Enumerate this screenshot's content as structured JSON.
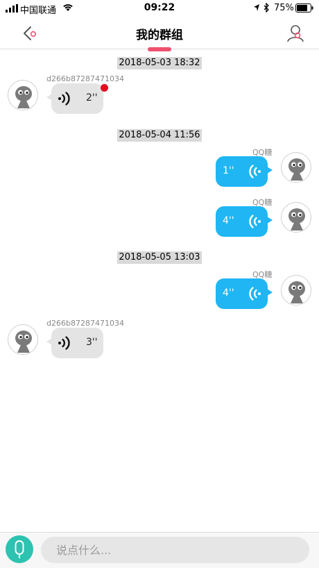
{
  "status_bar": {
    "carrier": "中国联通",
    "time": "09:22",
    "battery": "75%"
  },
  "nav": {
    "title": "我的群组",
    "accent_color": "#f0506e"
  },
  "messages": [
    {
      "type": "timestamp",
      "text": "2018-05-03 18:32"
    },
    {
      "type": "voice",
      "direction": "incoming",
      "sender": "d266b87287471034",
      "duration": "2''",
      "unread": true
    },
    {
      "type": "timestamp",
      "text": "2018-05-04 11:56"
    },
    {
      "type": "voice",
      "direction": "outgoing",
      "sender": "QQ糖",
      "duration": "1''"
    },
    {
      "type": "voice",
      "direction": "outgoing",
      "sender": "QQ糖",
      "duration": "4''"
    },
    {
      "type": "timestamp",
      "text": "2018-05-05 13:03"
    },
    {
      "type": "voice",
      "direction": "outgoing",
      "sender": "QQ糖",
      "duration": "4''"
    },
    {
      "type": "voice",
      "direction": "incoming",
      "sender": "d266b87287471034",
      "duration": "3''"
    }
  ],
  "input": {
    "placeholder": "说点什么..."
  },
  "colors": {
    "outgoing_bubble": "#1fb6f3",
    "incoming_bubble": "#e4e4e4",
    "mic_button": "#2ec2b0",
    "unread_dot": "#e01020"
  }
}
